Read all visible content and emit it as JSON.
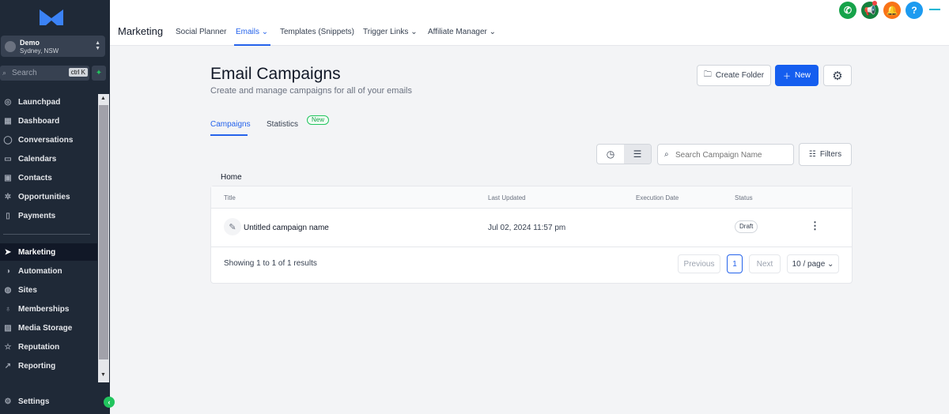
{
  "sidebar": {
    "account": {
      "name": "Demo",
      "location": "Sydney, NSW"
    },
    "search": {
      "label": "Search",
      "shortcut": "ctrl K"
    },
    "items": [
      {
        "label": "Launchpad",
        "icon": "launchpad-icon"
      },
      {
        "label": "Dashboard",
        "icon": "dashboard-icon"
      },
      {
        "label": "Conversations",
        "icon": "chat-icon"
      },
      {
        "label": "Calendars",
        "icon": "calendar-icon"
      },
      {
        "label": "Contacts",
        "icon": "contacts-icon"
      },
      {
        "label": "Opportunities",
        "icon": "opportunities-icon"
      },
      {
        "label": "Payments",
        "icon": "payments-icon"
      },
      {
        "label": "Marketing",
        "icon": "send-icon",
        "active": true
      },
      {
        "label": "Automation",
        "icon": "automation-icon"
      },
      {
        "label": "Sites",
        "icon": "globe-icon"
      },
      {
        "label": "Memberships",
        "icon": "badge-icon"
      },
      {
        "label": "Media Storage",
        "icon": "image-icon"
      },
      {
        "label": "Reputation",
        "icon": "star-icon"
      },
      {
        "label": "Reporting",
        "icon": "chart-icon"
      }
    ],
    "settings_label": "Settings"
  },
  "header": {
    "title": "Marketing",
    "tabs": [
      {
        "label": "Social Planner"
      },
      {
        "label": "Emails ⌄",
        "active": true
      },
      {
        "label": "Templates (Snippets)"
      },
      {
        "label": "Trigger Links ⌄"
      },
      {
        "label": "Affiliate Manager ⌄"
      }
    ],
    "actions": {
      "phone_color": "#16a34a",
      "announce_color": "#15803d",
      "bell_color": "#f97316",
      "help_color": "#1d9bf0",
      "help_label": "?"
    }
  },
  "page": {
    "title": "Email Campaigns",
    "subtitle": "Create and manage campaigns for all of your emails",
    "create_folder_label": "Create Folder",
    "new_label": "New",
    "tabs": [
      {
        "label": "Campaigns",
        "active": true
      },
      {
        "label": "Statistics",
        "badge": "New"
      }
    ],
    "search_placeholder": "Search Campaign Name",
    "filters_label": "Filters",
    "breadcrumb": "Home"
  },
  "table": {
    "columns": [
      "Title",
      "Last Updated",
      "Execution Date",
      "Status"
    ],
    "rows": [
      {
        "title": "Untitled campaign name",
        "last_updated": "Jul 02, 2024 11:57 pm",
        "execution_date": "",
        "status": "Draft"
      }
    ],
    "footer": {
      "showing": "Showing 1 to 1 of 1 results",
      "previous": "Previous",
      "page": "1",
      "next": "Next",
      "page_size": "10 / page ⌄"
    }
  },
  "colors": {
    "accent": "#155eef",
    "sidebar_bg": "#1f2937",
    "success": "#22c55e"
  }
}
